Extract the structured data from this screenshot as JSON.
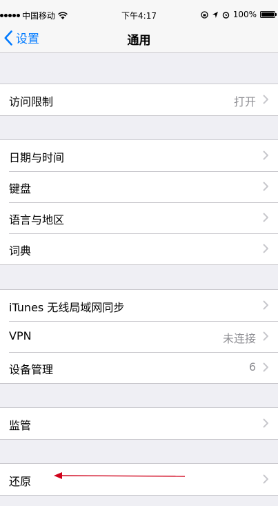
{
  "status_bar": {
    "carrier": "中国移动",
    "time": "下午4:17",
    "battery": "100%",
    "battery_level": 1.0
  },
  "nav": {
    "back_label": "设置",
    "title": "通用"
  },
  "groups": [
    {
      "items": [
        {
          "label": "访问限制",
          "detail": "打开"
        }
      ]
    },
    {
      "items": [
        {
          "label": "日期与时间",
          "detail": ""
        },
        {
          "label": "键盘",
          "detail": ""
        },
        {
          "label": "语言与地区",
          "detail": ""
        },
        {
          "label": "词典",
          "detail": ""
        }
      ]
    },
    {
      "items": [
        {
          "label": "iTunes 无线局域网同步",
          "detail": ""
        },
        {
          "label": "VPN",
          "detail": "未连接"
        },
        {
          "label": "设备管理",
          "detail": "6"
        }
      ]
    },
    {
      "items": [
        {
          "label": "监管",
          "detail": ""
        }
      ]
    },
    {
      "items": [
        {
          "label": "还原",
          "detail": ""
        }
      ]
    }
  ],
  "colors": {
    "accent": "#007aff",
    "background": "#efeff4",
    "annotation_arrow": "#d0021b"
  }
}
